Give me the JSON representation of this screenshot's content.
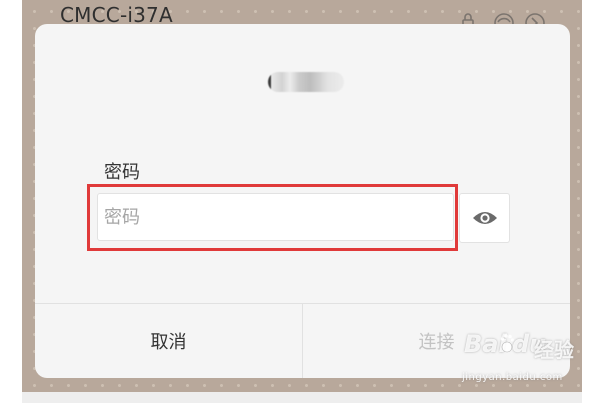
{
  "background": {
    "network_name": "CMCC-i37A"
  },
  "dialog": {
    "password_label": "密码",
    "password_input": {
      "value": "",
      "placeholder": "密码"
    },
    "toggle_visibility_icon": "eye-icon",
    "cancel_label": "取消",
    "connect_label": "连接"
  },
  "watermark": {
    "brand_left": "Bai",
    "brand_right": "du",
    "brand_suffix": "经验",
    "url": "jingyan.baidu.com"
  },
  "colors": {
    "highlight": "#e03a3a",
    "dialog_bg": "#f5f5f5",
    "backdrop": "#b8a89b",
    "disabled_text": "#c3c3c3"
  }
}
